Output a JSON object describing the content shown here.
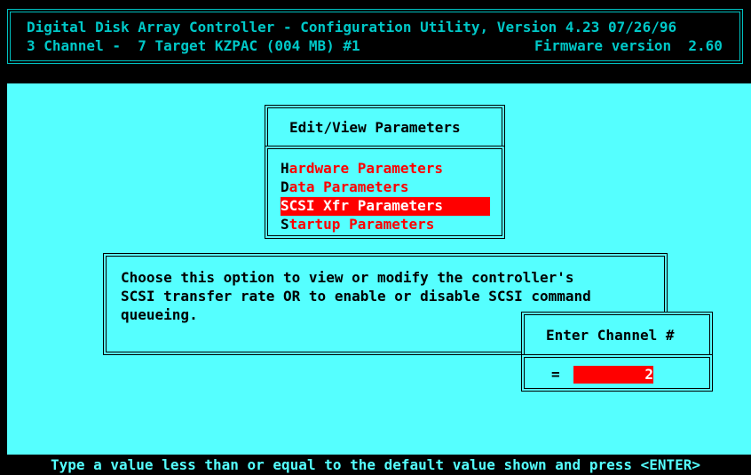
{
  "header": {
    "line1": "Digital Disk Array Controller - Configuration Utility, Version 4.23 07/26/96",
    "line2_left": "3 Channel -  7 Target KZPAC (004 MB) #1",
    "line2_right": "Firmware version  2.60"
  },
  "menu": {
    "title": "Edit/View Parameters",
    "items": [
      {
        "hotkey": "H",
        "rest": "ardware Parameters",
        "selected": false
      },
      {
        "hotkey": "D",
        "rest": "ata Parameters",
        "selected": false
      },
      {
        "hotkey": "S",
        "rest": "CSI Xfr Parameters",
        "selected": true
      },
      {
        "hotkey": "S",
        "rest": "tartup Parameters",
        "selected": false
      }
    ]
  },
  "help": {
    "lines": [
      "Choose this option to view or modify the controller's",
      "SCSI transfer rate OR to enable or disable SCSI command",
      "queueing."
    ]
  },
  "channel_dialog": {
    "title": "Enter Channel #",
    "prefix": "=",
    "value": "2"
  },
  "status_bar": "Type a value less than or equal to the default value shown and press <ENTER>",
  "colors": {
    "background": "#55ffff",
    "highlight": "#ff0000",
    "header_text": "#00c8c8"
  }
}
